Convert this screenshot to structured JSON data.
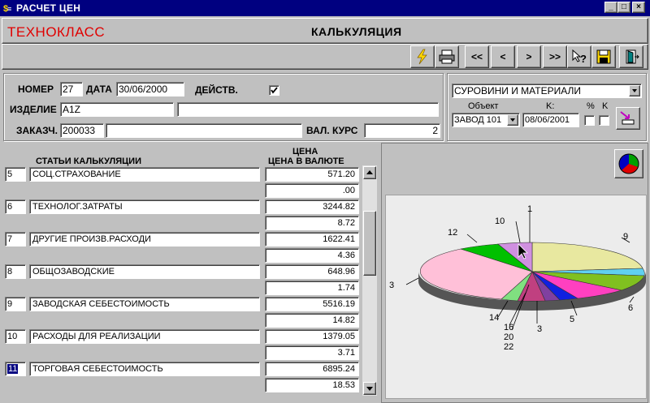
{
  "window": {
    "title": "РАСЧЕТ ЦЕН"
  },
  "header": {
    "brand": "ТЕХНОКЛАСС",
    "title": "КАЛЬКУЛЯЦИЯ"
  },
  "toolbar": {
    "first": "<<",
    "prev": "<",
    "next": ">",
    "last": ">>"
  },
  "form": {
    "number_label": "НОМЕР",
    "number_value": "27",
    "date_label": "ДАТА",
    "date_value": "30/06/2000",
    "active_label": "ДЕЙСТВ.",
    "active_checked": true,
    "product_label": "ИЗДЕЛИЕ",
    "product_code": "A1Z",
    "product_name": "",
    "customer_label": "ЗАКАЗЧ.",
    "customer_code": "200033",
    "customer_name": "",
    "rate_label": "ВАЛ. КУРС",
    "rate_value": "2"
  },
  "right_panel": {
    "category_value": "СУРОВИНИ И МАТЕРИАЛИ",
    "object_label": "Объект",
    "object_value": "ЗАВОД 101",
    "k_label": "K:",
    "k_date": "08/06/2001",
    "percent_label": "%",
    "k_check_label": "K"
  },
  "table": {
    "col_items": "СТАТЬИ  КАЛЬКУЛЯЦИИ",
    "col_price_1": "ЦЕНА",
    "col_price_2": "ЦЕНА  В ВАЛЮТЕ",
    "rows": [
      {
        "num": "5",
        "name": "СОЦ.СТРАХОВАНИЕ",
        "price": "571.20",
        "currency": ".00"
      },
      {
        "num": "6",
        "name": "ТЕХНОЛОГ.ЗАТРАТЫ",
        "price": "3244.82",
        "currency": "8.72"
      },
      {
        "num": "7",
        "name": "ДРУГИЕ ПРОИЗВ.РАСХОДИ",
        "price": "1622.41",
        "currency": "4.36"
      },
      {
        "num": "8",
        "name": "ОБЩОЗАВОДСКИЕ",
        "price": "648.96",
        "currency": "1.74"
      },
      {
        "num": "9",
        "name": "ЗАВОДСКАЯ СЕБЕСТОИМОСТЬ",
        "price": "5516.19",
        "currency": "14.82"
      },
      {
        "num": "10",
        "name": "РАСХОДЫ ДЛЯ РЕАЛИЗАЦИИ",
        "price": "1379.05",
        "currency": "3.71"
      },
      {
        "num": "11",
        "name": "ТОРГОВАЯ СЕБЕСТОИМОСТЬ",
        "price": "6895.24",
        "currency": "18.53"
      }
    ]
  },
  "pie_labels": [
    "1",
    "9",
    "6",
    "5",
    "3",
    "16",
    "20",
    "22",
    "14",
    "3",
    "12",
    "10"
  ],
  "colors": {
    "titlebar": "#000080",
    "brand": "#e00000",
    "pie_bg": "#ececec"
  }
}
